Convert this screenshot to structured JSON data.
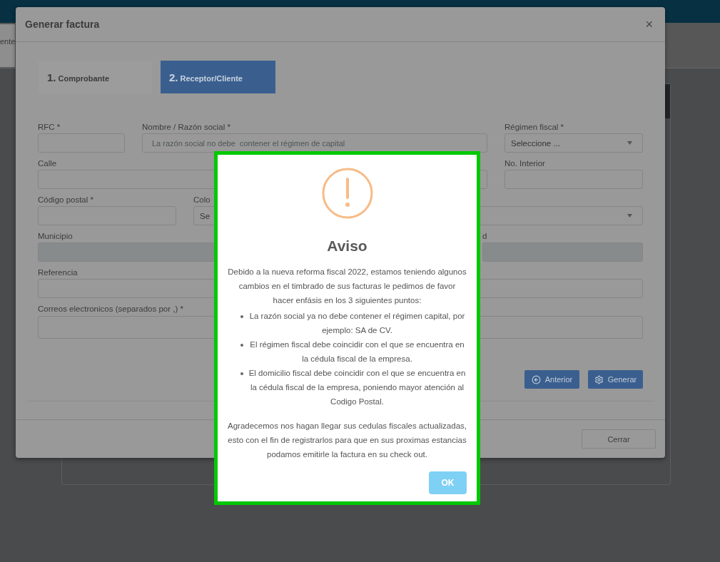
{
  "background": {
    "fragment": "ente"
  },
  "dialog": {
    "title": "Generar factura",
    "close": "×",
    "steps": [
      {
        "number": "1.",
        "label": "Comprobante",
        "selected": false
      },
      {
        "number": "2.",
        "label": "Receptor/Cliente",
        "selected": true
      }
    ],
    "fields": [
      {
        "label": "RFC *",
        "kind": "input"
      },
      {
        "label": "Nombre / Razón social *",
        "kind": "input",
        "placeholder": "La razón social no debe  contener el régimen de capital"
      },
      {
        "label": "Régimen fiscal *",
        "kind": "select",
        "value": "Seleccione ..."
      },
      {
        "label": "Calle",
        "kind": "input"
      },
      {
        "label": "No. Interior",
        "kind": "input"
      },
      {
        "label": "Código postal *",
        "kind": "input"
      },
      {
        "label": "Colo",
        "kind": "select",
        "value": "Se"
      },
      {
        "label": "Municipio",
        "kind": "disabled"
      },
      {
        "label": "d",
        "kind": "disabled"
      },
      {
        "label": "Referencia",
        "kind": "input"
      },
      {
        "label": "Correos electronicos (separados por ,) *",
        "kind": "textarea"
      }
    ],
    "actions": [
      {
        "label": "Anterior",
        "kind": "back"
      },
      {
        "label": "Generar",
        "kind": "generate"
      }
    ],
    "footer_button": "Cerrar"
  },
  "alert": {
    "title": "Aviso",
    "intro": "Debido a la nueva reforma fiscal 2022, estamos teniendo algunos cambios en el timbrado de sus facturas le pedimos de favor hacer enfásis en los 3 siguientes puntos:",
    "points": [
      "La razón social ya no debe contener el régimen capital, por ejemplo: SA de CV.",
      "El régimen fiscal debe coincidir con el que se encuentra en la cédula fiscal de la empresa.",
      "El domicilio fiscal debe coincidir con el que se encuentra en la cédula fiscal de la empresa, poniendo mayor atención al Codigo Postal."
    ],
    "closing": "Agradecemos nos hagan llegar sus cedulas fiscales actualizadas, esto con el fin de registrarlos para que en sus proximas estancias podamos emitirle la factura en su check out.",
    "button": "OK"
  }
}
